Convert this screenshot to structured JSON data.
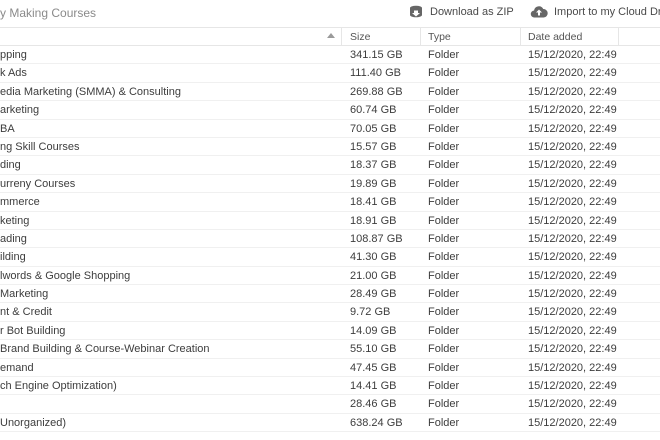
{
  "breadcrumb": "y Making Courses",
  "actions": {
    "download_zip": "Download as ZIP",
    "import_cloud": "Import to my Cloud Drive"
  },
  "columns": {
    "name": "",
    "size": "Size",
    "type": "Type",
    "date": "Date added"
  },
  "rows": [
    {
      "name": "pping",
      "size": "341.15 GB",
      "type": "Folder",
      "date": "15/12/2020, 22:49"
    },
    {
      "name": "k Ads",
      "size": "111.40 GB",
      "type": "Folder",
      "date": "15/12/2020, 22:49"
    },
    {
      "name": "edia Marketing (SMMA) & Consulting",
      "size": "269.88 GB",
      "type": "Folder",
      "date": "15/12/2020, 22:49"
    },
    {
      "name": "arketing",
      "size": "60.74 GB",
      "type": "Folder",
      "date": "15/12/2020, 22:49"
    },
    {
      "name": "BA",
      "size": "70.05 GB",
      "type": "Folder",
      "date": "15/12/2020, 22:49"
    },
    {
      "name": "ng Skill Courses",
      "size": "15.57 GB",
      "type": "Folder",
      "date": "15/12/2020, 22:49"
    },
    {
      "name": "ding",
      "size": "18.37 GB",
      "type": "Folder",
      "date": "15/12/2020, 22:49"
    },
    {
      "name": "urreny Courses",
      "size": "19.89 GB",
      "type": "Folder",
      "date": "15/12/2020, 22:49"
    },
    {
      "name": "mmerce",
      "size": "18.41 GB",
      "type": "Folder",
      "date": "15/12/2020, 22:49"
    },
    {
      "name": "keting",
      "size": "18.91 GB",
      "type": "Folder",
      "date": "15/12/2020, 22:49"
    },
    {
      "name": "ading",
      "size": "108.87 GB",
      "type": "Folder",
      "date": "15/12/2020, 22:49"
    },
    {
      "name": "ilding",
      "size": "41.30 GB",
      "type": "Folder",
      "date": "15/12/2020, 22:49"
    },
    {
      "name": "lwords & Google Shopping",
      "size": "21.00 GB",
      "type": "Folder",
      "date": "15/12/2020, 22:49"
    },
    {
      "name": " Marketing",
      "size": "28.49 GB",
      "type": "Folder",
      "date": "15/12/2020, 22:49"
    },
    {
      "name": "nt & Credit",
      "size": "9.72 GB",
      "type": "Folder",
      "date": "15/12/2020, 22:49"
    },
    {
      "name": "r Bot Building",
      "size": "14.09 GB",
      "type": "Folder",
      "date": "15/12/2020, 22:49"
    },
    {
      "name": "Brand Building & Course-Webinar Creation",
      "size": "55.10 GB",
      "type": "Folder",
      "date": "15/12/2020, 22:49"
    },
    {
      "name": "emand",
      "size": "47.45 GB",
      "type": "Folder",
      "date": "15/12/2020, 22:49"
    },
    {
      "name": "ch Engine Optimization)",
      "size": "14.41 GB",
      "type": "Folder",
      "date": "15/12/2020, 22:49"
    },
    {
      "name": "",
      "size": "28.46 GB",
      "type": "Folder",
      "date": "15/12/2020, 22:49"
    },
    {
      "name": "Unorganized)",
      "size": "638.24 GB",
      "type": "Folder",
      "date": "15/12/2020, 22:49"
    },
    {
      "name": "",
      "size": "",
      "type": "",
      "date": ""
    }
  ]
}
